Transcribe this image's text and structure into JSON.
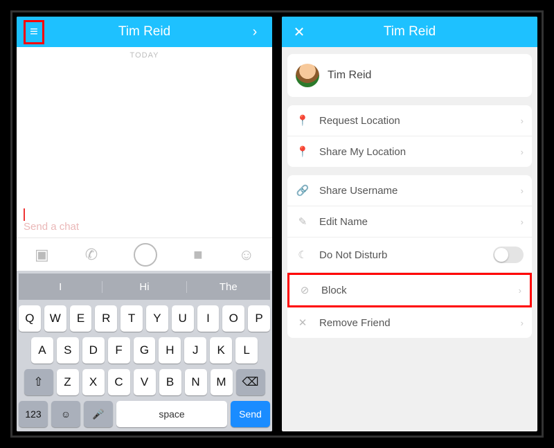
{
  "left": {
    "header": {
      "title": "Tim Reid",
      "menu_icon": "≡",
      "right_icon": "›"
    },
    "chat": {
      "today_label": "TODAY",
      "input_placeholder": "Send a chat"
    },
    "toolbar_icons": {
      "gallery": "gallery-icon",
      "call": "phone-icon",
      "shutter": "shutter-icon",
      "video": "video-icon",
      "emoji": "smile-icon"
    },
    "keyboard": {
      "suggestions": [
        "I",
        "Hi",
        "The"
      ],
      "row1": [
        "Q",
        "W",
        "E",
        "R",
        "T",
        "Y",
        "U",
        "I",
        "O",
        "P"
      ],
      "row2": [
        "A",
        "S",
        "D",
        "F",
        "G",
        "H",
        "J",
        "K",
        "L"
      ],
      "row3_shift": "⇧",
      "row3": [
        "Z",
        "X",
        "C",
        "V",
        "B",
        "N",
        "M"
      ],
      "row3_bksp": "⌫",
      "row4": {
        "numkey": "123",
        "emoji": "☺",
        "mic": "🎤",
        "space": "space",
        "send": "Send"
      }
    }
  },
  "right": {
    "header": {
      "title": "Tim Reid",
      "close_icon": "✕"
    },
    "profile": {
      "name": "Tim Reid"
    },
    "group1": [
      {
        "icon": "📍",
        "label": "Request Location",
        "name": "request-location"
      },
      {
        "icon": "📍",
        "label": "Share My Location",
        "name": "share-my-location"
      }
    ],
    "group2": [
      {
        "icon": "🔗",
        "label": "Share Username",
        "name": "share-username"
      },
      {
        "icon": "✎",
        "label": "Edit Name",
        "name": "edit-name"
      },
      {
        "icon": "☾",
        "label": "Do Not Disturb",
        "name": "do-not-disturb",
        "toggle": true
      },
      {
        "icon": "⊘",
        "label": "Block",
        "name": "block",
        "highlight": true
      },
      {
        "icon": "✕",
        "label": "Remove Friend",
        "name": "remove-friend"
      }
    ]
  }
}
